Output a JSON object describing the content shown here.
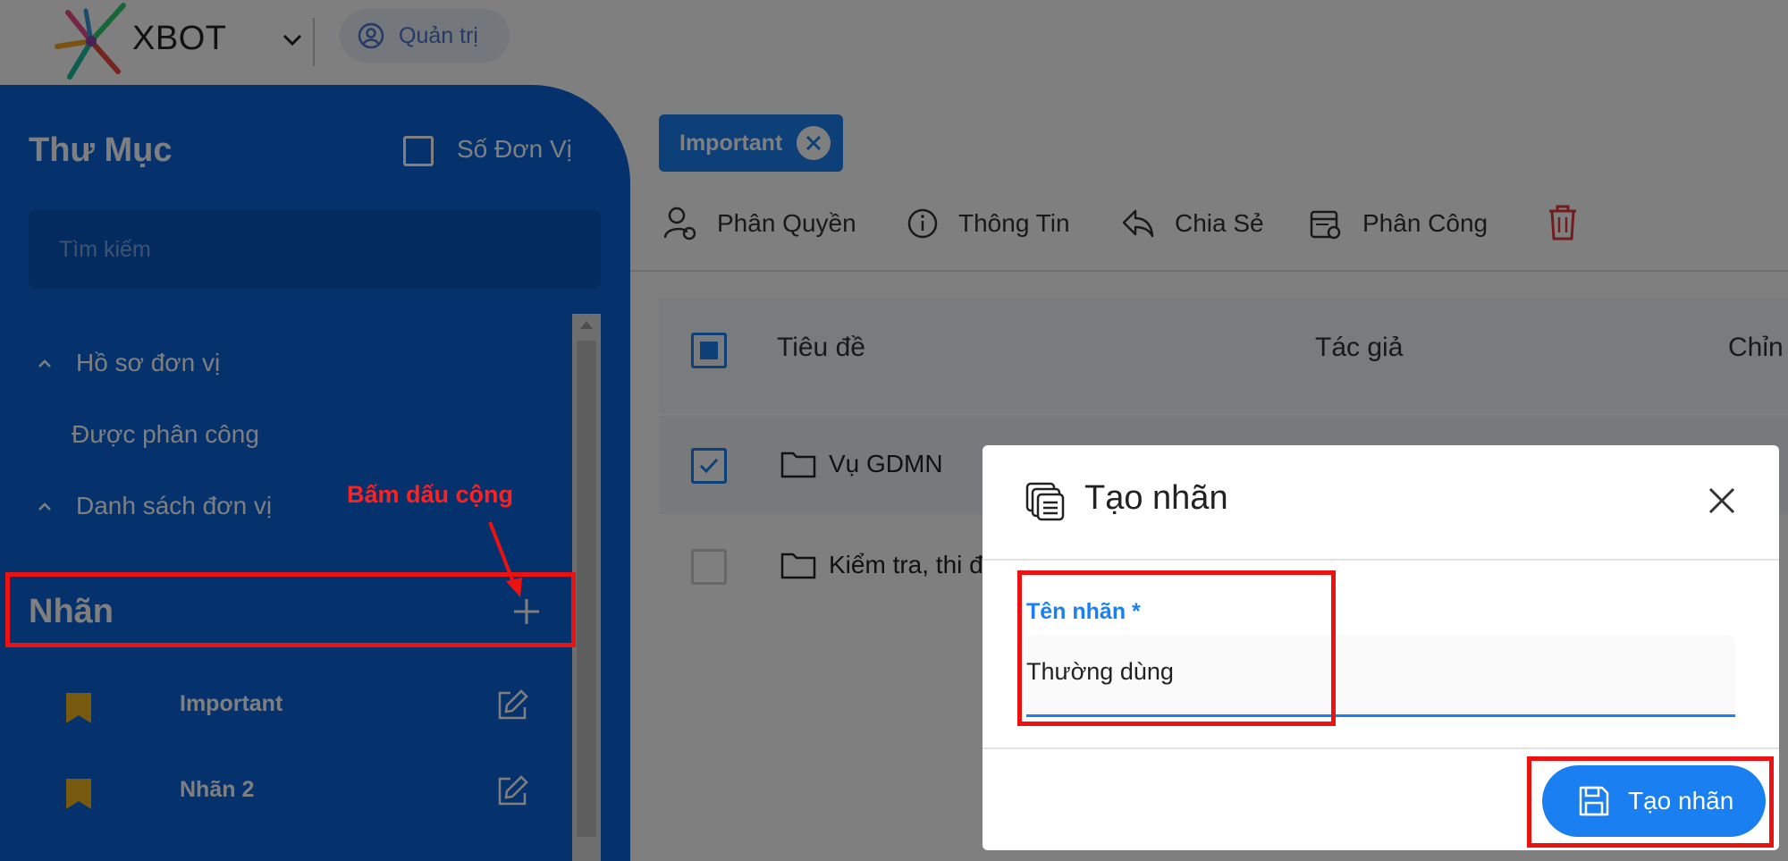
{
  "app": {
    "brand": "XBOT",
    "role_label": "Quản trị"
  },
  "sidebar": {
    "title": "Thư Mục",
    "checkbox_label": "Số Đơn Vị",
    "search_placeholder": "Tìm kiếm",
    "tree": [
      {
        "label": "Hồ sơ đơn vị",
        "expanded": true
      },
      {
        "label": "Được phân công"
      },
      {
        "label": "Danh sách đơn vị",
        "expanded": true
      }
    ],
    "labels_heading": "Nhãn",
    "labels": [
      {
        "label": "Important",
        "color": "#f0b41c"
      },
      {
        "label": "Nhãn 2",
        "color": "#f0b41c"
      }
    ]
  },
  "main": {
    "filter_chip": "Important",
    "toolbar": {
      "permissions": "Phân Quyền",
      "info": "Thông Tin",
      "share": "Chia Sẻ",
      "assign": "Phân Công"
    },
    "table": {
      "columns": [
        "Tiêu đề",
        "Tác giả",
        "Chỉn"
      ],
      "rows": [
        {
          "title": "Vụ GDMN",
          "checked": true
        },
        {
          "title": "Kiểm tra, thi đ",
          "checked": false
        }
      ]
    }
  },
  "modal": {
    "title": "Tạo nhãn",
    "field_label": "Tên nhãn *",
    "field_value": "Thường dùng",
    "submit_label": "Tạo nhãn"
  },
  "annotation": {
    "text": "Bấm dấu cộng"
  },
  "colors": {
    "sidebar_bg": "#0a65d9",
    "accent": "#1a7ff0",
    "bookmark": "#f0b41c",
    "delete": "#e23b3b",
    "annotation": "#ee1111"
  }
}
